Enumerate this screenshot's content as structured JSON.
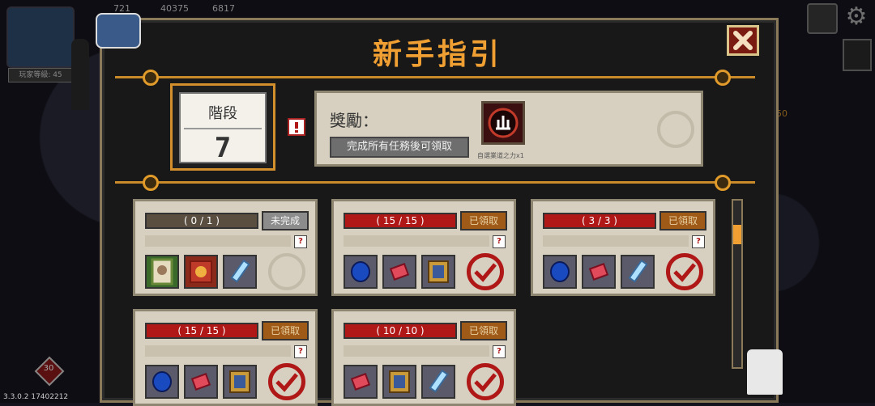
{
  "hud": {
    "top_values": [
      "721",
      "40375",
      "6817"
    ],
    "player_level": "玩家等級: 45",
    "badge_number": "30",
    "side_value": "50",
    "version": "3.3.0.2 17402212"
  },
  "dialog": {
    "title": "新手指引",
    "stage": {
      "label": "階段",
      "number": "7"
    },
    "reward": {
      "label": "獎勵：",
      "button_label": "完成所有任務後可領取",
      "item_caption": "自選業道之力x1",
      "item_icon": "karma-power-icon"
    }
  },
  "tasks": [
    {
      "progress": "( 0 / 1 )",
      "status": "未完成",
      "state": "pending",
      "items": [
        "card-icon",
        "ticket-icon",
        "potion-icon"
      ],
      "slot": "empty"
    },
    {
      "progress": "( 15 / 15 )",
      "status": "已領取",
      "state": "claimed",
      "items": [
        "blue-gem-icon",
        "red-gem-icon",
        "treasure-box-icon"
      ],
      "slot": "check"
    },
    {
      "progress": "( 3 / 3 )",
      "status": "已領取",
      "state": "claimed",
      "items": [
        "blue-gem-icon",
        "red-gem-icon",
        "potion-icon"
      ],
      "slot": "check"
    },
    {
      "progress": "( 15 / 15 )",
      "status": "已領取",
      "state": "claimed",
      "items": [
        "blue-gem-icon",
        "red-gem-icon",
        "treasure-box-icon"
      ],
      "slot": "check"
    },
    {
      "progress": "( 10 / 10 )",
      "status": "已領取",
      "state": "claimed",
      "items": [
        "red-gem-icon",
        "treasure-box-icon",
        "potion-icon"
      ],
      "slot": "check"
    }
  ],
  "colors": {
    "accent": "#f0a033",
    "claimed_bar": "#b01818",
    "panel_bg": "#d7d0c0"
  }
}
